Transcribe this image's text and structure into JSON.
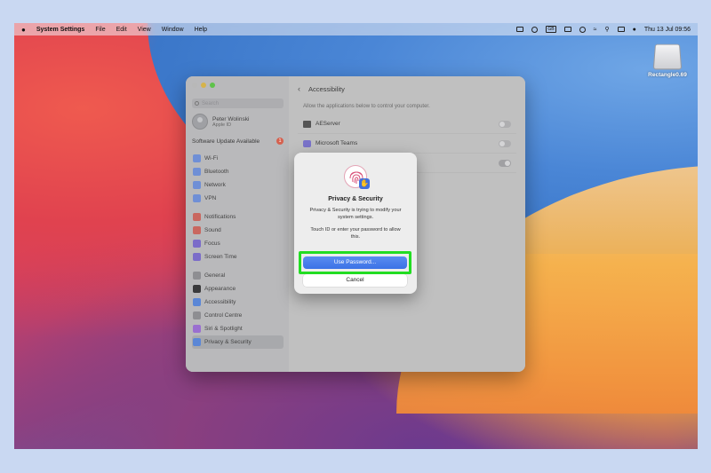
{
  "menubar": {
    "app_name": "System Settings",
    "menus": [
      "File",
      "Edit",
      "View",
      "Window",
      "Help"
    ],
    "clock": "Thu 13 Jul  09:56",
    "badge_text": "GB"
  },
  "desktop": {
    "drive_label": "Rectangle0.69"
  },
  "sidebar": {
    "search_placeholder": "Search",
    "user_name": "Peter Wolinski",
    "user_sub": "Apple ID",
    "update_label": "Software Update Available",
    "update_count": "1",
    "groups": [
      [
        {
          "label": "Wi-Fi",
          "color": "#6f8fd6"
        },
        {
          "label": "Bluetooth",
          "color": "#6f8fd6"
        },
        {
          "label": "Network",
          "color": "#6f8fd6"
        },
        {
          "label": "VPN",
          "color": "#6f8fd6"
        }
      ],
      [
        {
          "label": "Notifications",
          "color": "#c9675f"
        },
        {
          "label": "Sound",
          "color": "#c9675f"
        },
        {
          "label": "Focus",
          "color": "#7b6cc9"
        },
        {
          "label": "Screen Time",
          "color": "#7b6cc9"
        }
      ],
      [
        {
          "label": "General",
          "color": "#8e8e92"
        },
        {
          "label": "Appearance",
          "color": "#3a3a3c"
        },
        {
          "label": "Accessibility",
          "color": "#5b87d6"
        },
        {
          "label": "Control Centre",
          "color": "#8e8e92"
        },
        {
          "label": "Siri & Spotlight",
          "color": "#9a6fd0"
        },
        {
          "label": "Privacy & Security",
          "color": "#5b87d6"
        }
      ]
    ]
  },
  "main": {
    "title": "Accessibility",
    "intro": "Allow the applications below to control your computer.",
    "apps": [
      {
        "name": "AEServer",
        "enabled": false
      },
      {
        "name": "Microsoft Teams",
        "enabled": false
      },
      {
        "name": "",
        "enabled": true
      }
    ]
  },
  "dialog": {
    "title": "Privacy & Security",
    "message": "Privacy & Security is trying to modify your system settings.",
    "message2": "Touch ID or enter your password to allow this.",
    "primary_label": "Use Password...",
    "cancel_label": "Cancel"
  }
}
